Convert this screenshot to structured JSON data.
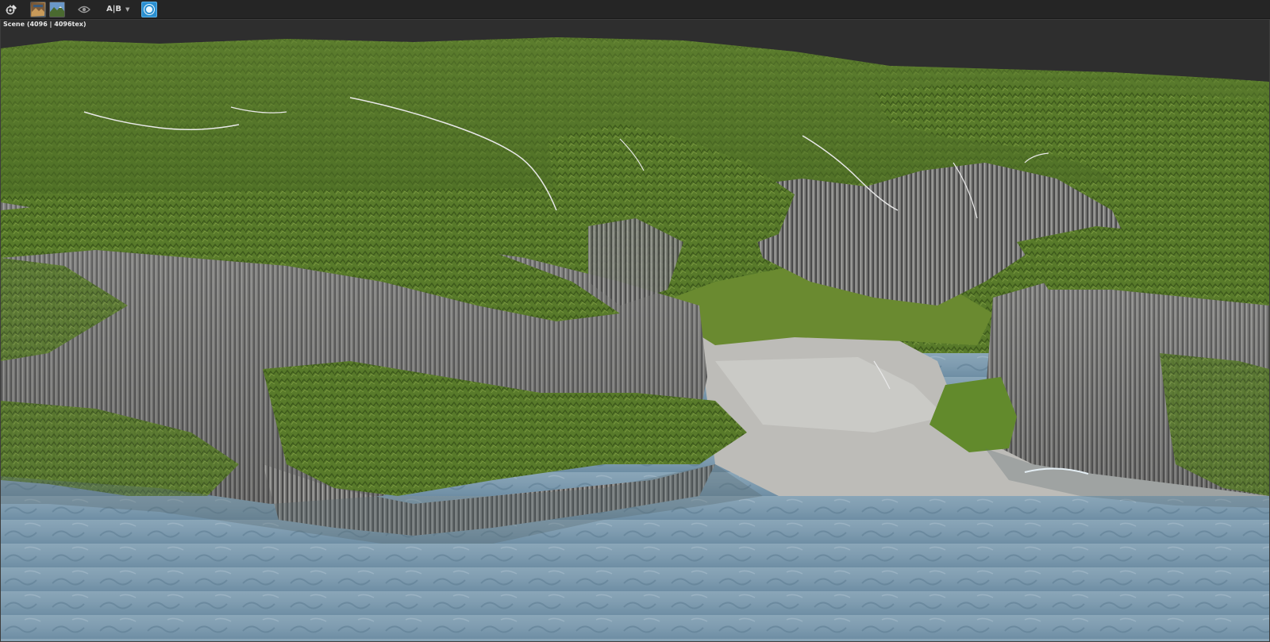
{
  "toolbar": {
    "buttons": [
      {
        "name": "scene-settings-button",
        "icon": "gear-paint-icon"
      },
      {
        "name": "render-button",
        "icon": "render-thumbnail-icon"
      },
      {
        "name": "landscape-view-button",
        "icon": "landscape-thumbnail-icon"
      },
      {
        "name": "visibility-toggle",
        "icon": "eye-icon"
      },
      {
        "name": "ab-compare-dropdown",
        "icon": "chevron-down-icon"
      },
      {
        "name": "active-view-toggle",
        "icon": "target-icon"
      }
    ],
    "ab_label": "A|B"
  },
  "viewport": {
    "label": "Scene (4096 | 4096tex)",
    "colors": {
      "background": "#2e2e2e",
      "grass": "#5a7a2a",
      "grass_dark": "#3e5a1c",
      "rock": "#8a8a8a",
      "rock_dark": "#4a4a4a",
      "sand": "#b8b8b4",
      "water": "#7f9fb4",
      "water_dark": "#5a7a90",
      "accent": "#2a8fd0"
    }
  }
}
